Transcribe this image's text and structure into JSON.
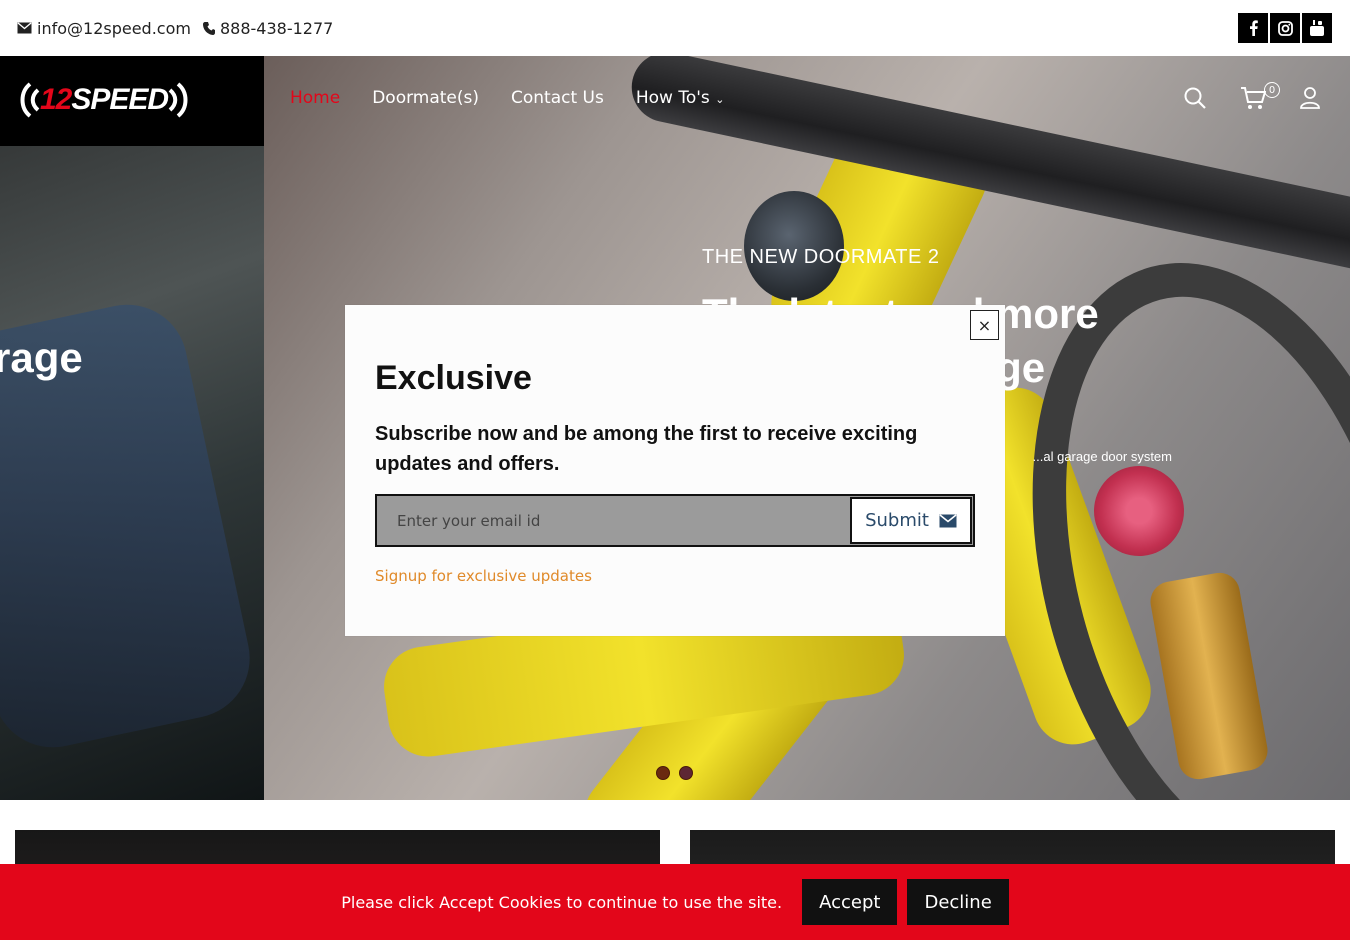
{
  "topbar": {
    "email": "info@12speed.com",
    "phone": "888-438-1277",
    "socials": [
      {
        "name": "facebook",
        "icon": "facebook-icon"
      },
      {
        "name": "instagram",
        "icon": "instagram-icon"
      },
      {
        "name": "youtube",
        "icon": "youtube-icon"
      }
    ]
  },
  "header": {
    "logo_prefix": "((",
    "logo_num": "12",
    "logo_word": "SPEED",
    "logo_suffix": "))",
    "nav": [
      {
        "label": "Home",
        "active": true
      },
      {
        "label": "Doormate(s)",
        "active": false
      },
      {
        "label": "Contact Us",
        "active": false
      },
      {
        "label": "How To's",
        "active": false,
        "dropdown": true
      }
    ],
    "cart_count": "0"
  },
  "hero": {
    "left_slide_text": "rage",
    "kicker": "THE NEW DOORMATE 2",
    "title": "The latest and more advanced garage",
    "description": "...al garage door system"
  },
  "modal": {
    "title": "Exclusive",
    "lead": "Subscribe now and be among the first to receive exciting updates and offers.",
    "email_placeholder": "Enter your email id",
    "submit_label": "Submit",
    "note": "Signup for exclusive updates",
    "close_label": "×"
  },
  "cookie": {
    "message": "Please click Accept Cookies to continue to use the site.",
    "accept_label": "Accept",
    "decline_label": "Decline"
  },
  "colors": {
    "brand_red": "#e3061a",
    "note_orange": "#e08a2a"
  }
}
